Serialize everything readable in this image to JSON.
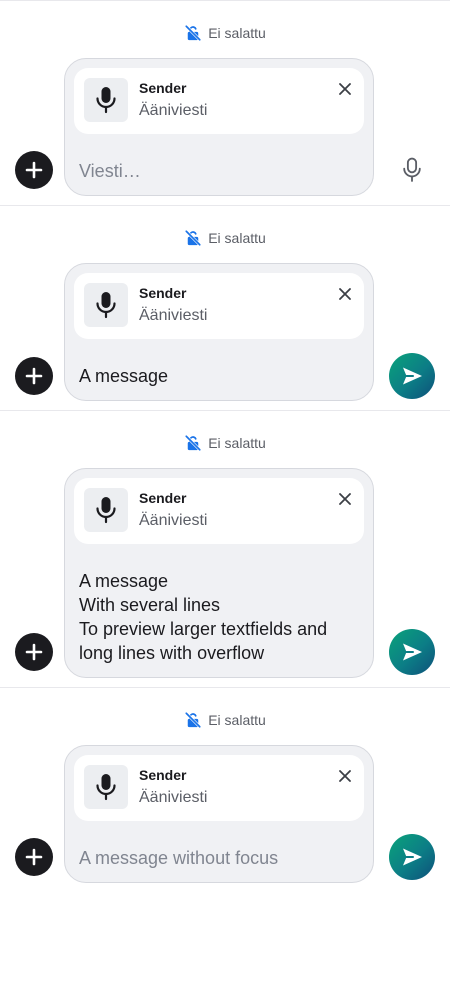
{
  "variants": [
    {
      "encryption_label": "Ei salattu",
      "reply": {
        "sender": "Sender",
        "body": "Ääniviesti"
      },
      "message": {
        "placeholder": "Viesti…",
        "text": ""
      },
      "action": "mic"
    },
    {
      "encryption_label": "Ei salattu",
      "reply": {
        "sender": "Sender",
        "body": "Ääniviesti"
      },
      "message": {
        "placeholder": "",
        "text": "A message"
      },
      "action": "send"
    },
    {
      "encryption_label": "Ei salattu",
      "reply": {
        "sender": "Sender",
        "body": "Ääniviesti"
      },
      "message": {
        "placeholder": "",
        "text": "A message\nWith several lines\nTo preview larger textfields and long lines with overflow"
      },
      "action": "send"
    },
    {
      "encryption_label": "Ei salattu",
      "reply": {
        "sender": "Sender",
        "body": "Ääniviesti"
      },
      "message": {
        "placeholder": "A message without focus",
        "text": ""
      },
      "action": "send"
    }
  ],
  "icons": {
    "encryption": "lock-off-icon",
    "reply_thumb": "microphone-icon",
    "reply_close": "close-icon",
    "add": "plus-icon",
    "mic": "microphone-icon",
    "send": "send-icon"
  },
  "colors": {
    "accent_blue": "#1a73e8",
    "send_gradient_start": "#0aa37a",
    "send_gradient_end": "#0e4f7a",
    "composer_bg": "#f0f1f4"
  }
}
